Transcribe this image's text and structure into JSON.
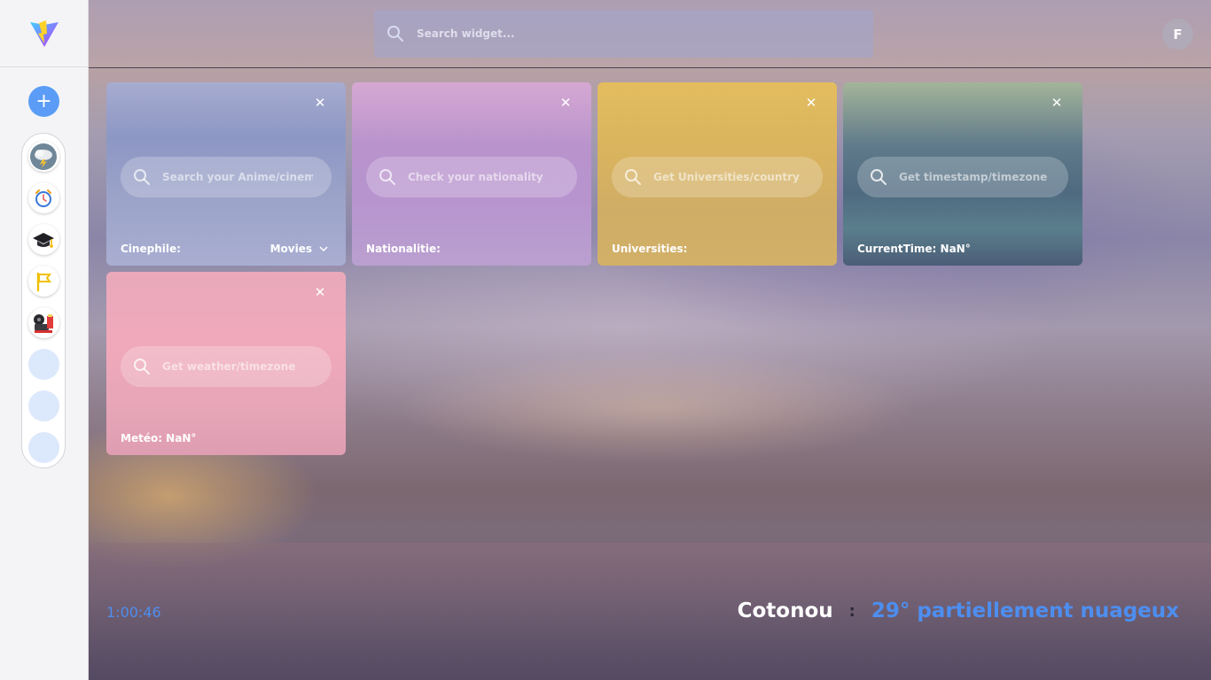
{
  "sidebar": {
    "logo_icon": "vite-lightning-logo",
    "add_label": "+",
    "widgets": [
      {
        "icon": "weather-storm-icon"
      },
      {
        "icon": "alarm-clock-icon"
      },
      {
        "icon": "graduation-cap-icon"
      },
      {
        "icon": "flag-icon"
      },
      {
        "icon": "cinema-icon"
      },
      {
        "icon": "empty-slot"
      },
      {
        "icon": "empty-slot"
      },
      {
        "icon": "empty-slot"
      }
    ]
  },
  "header": {
    "search_placeholder": "Search widget...",
    "avatar_initial": "F"
  },
  "cards": {
    "cinephile": {
      "placeholder": "Search your Anime/cinema",
      "label": "Cinephile:",
      "select_value": "Movies",
      "close": "✕"
    },
    "nationality": {
      "placeholder": "Check your nationality",
      "label": "Nationalitie:",
      "close": "✕"
    },
    "universities": {
      "placeholder": "Get Universities/country",
      "label": "Universities:",
      "close": "✕"
    },
    "current_time": {
      "placeholder": "Get timestamp/timezone",
      "label": "CurrentTime: NaN°",
      "close": "✕"
    },
    "meteo": {
      "placeholder": "Get weather/timezone",
      "label": "Metéo: NaN°",
      "close": "✕"
    }
  },
  "status": {
    "clock": "1:00:46",
    "city": "Cotonou",
    "separator": ":",
    "condition": "29° partiellement nuageux"
  },
  "colors": {
    "accent_blue": "#4d8ef0",
    "add_button": "#5b9cf6"
  }
}
